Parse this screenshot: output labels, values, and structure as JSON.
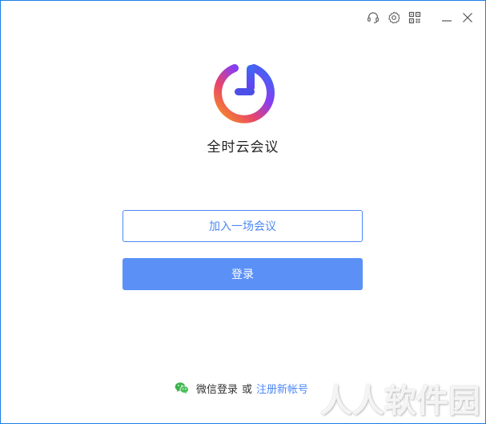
{
  "app": {
    "name": "全时云会议"
  },
  "titlebar": {
    "icons": [
      "headset-icon",
      "gear-icon",
      "qr-code-icon",
      "minimize-icon",
      "close-icon"
    ]
  },
  "main": {
    "join_label": "加入一场会议",
    "login_label": "登录"
  },
  "footer": {
    "wechat_login": "微信登录",
    "or": "或",
    "register": "注册新帐号"
  },
  "watermark": {
    "text": "人人软件园"
  },
  "colors": {
    "accent": "#4d88f5",
    "login_bg": "#5b90f7",
    "window_border": "#1e7ee6",
    "wechat_green": "#3bb34a"
  }
}
